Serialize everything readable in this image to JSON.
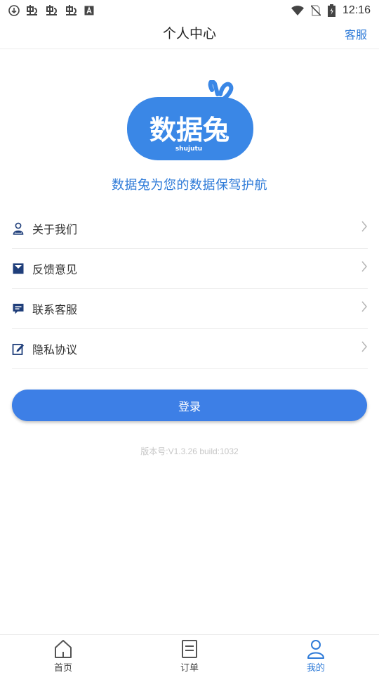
{
  "status_bar": {
    "time": "12:16",
    "left_icons": [
      "download-icon",
      "app-notification-icon",
      "app-notification-icon",
      "app-notification-icon",
      "a-box-icon"
    ],
    "right_icons": [
      "wifi-icon",
      "no-sim-icon",
      "battery-charging-icon"
    ]
  },
  "header": {
    "title": "个人中心",
    "action_label": "客服"
  },
  "logo": {
    "text": "数据兔",
    "subtext": "shujutu",
    "color": "#3a87e6"
  },
  "tagline": "数据兔为您的数据保驾护航",
  "menu": {
    "items": [
      {
        "label": "关于我们",
        "icon": "person-badge-icon"
      },
      {
        "label": "反馈意见",
        "icon": "feedback-icon"
      },
      {
        "label": "联系客服",
        "icon": "chat-icon"
      },
      {
        "label": "隐私协议",
        "icon": "privacy-doc-icon"
      }
    ]
  },
  "login_button": {
    "label": "登录"
  },
  "version": "版本号:V1.3.26 build:1032",
  "tabbar": {
    "tabs": [
      {
        "label": "首页",
        "icon": "home-icon",
        "active": false
      },
      {
        "label": "订单",
        "icon": "order-list-icon",
        "active": false
      },
      {
        "label": "我的",
        "icon": "person-icon",
        "active": true
      }
    ]
  },
  "colors": {
    "accent": "#2f7bd8",
    "button": "#3d7fe6",
    "icon_navy": "#1f3e7a"
  }
}
